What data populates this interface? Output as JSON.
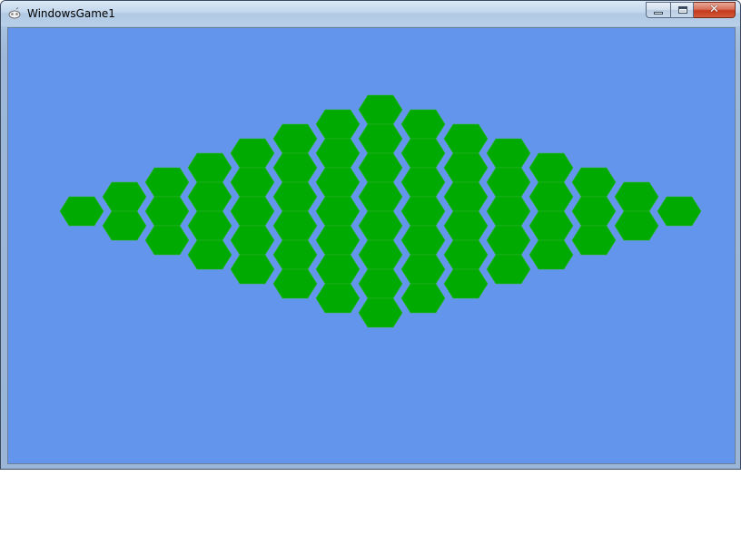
{
  "window": {
    "title": "WindowsGame1",
    "icon": "xna-controller-icon",
    "controls": {
      "minimize_icon": "minimize-icon",
      "maximize_icon": "maximize-icon",
      "close_icon": "close-icon",
      "close_glyph": "✕"
    }
  },
  "game": {
    "background_color": "#6495ED",
    "tile_color": "#00AA00",
    "tile_edge_color": "#2DB32D",
    "board": {
      "shape": "diamond",
      "tile_shape": "hexagon",
      "diagonal_rows": 8,
      "diagonal_columns": 8,
      "tile_count": 64
    }
  }
}
